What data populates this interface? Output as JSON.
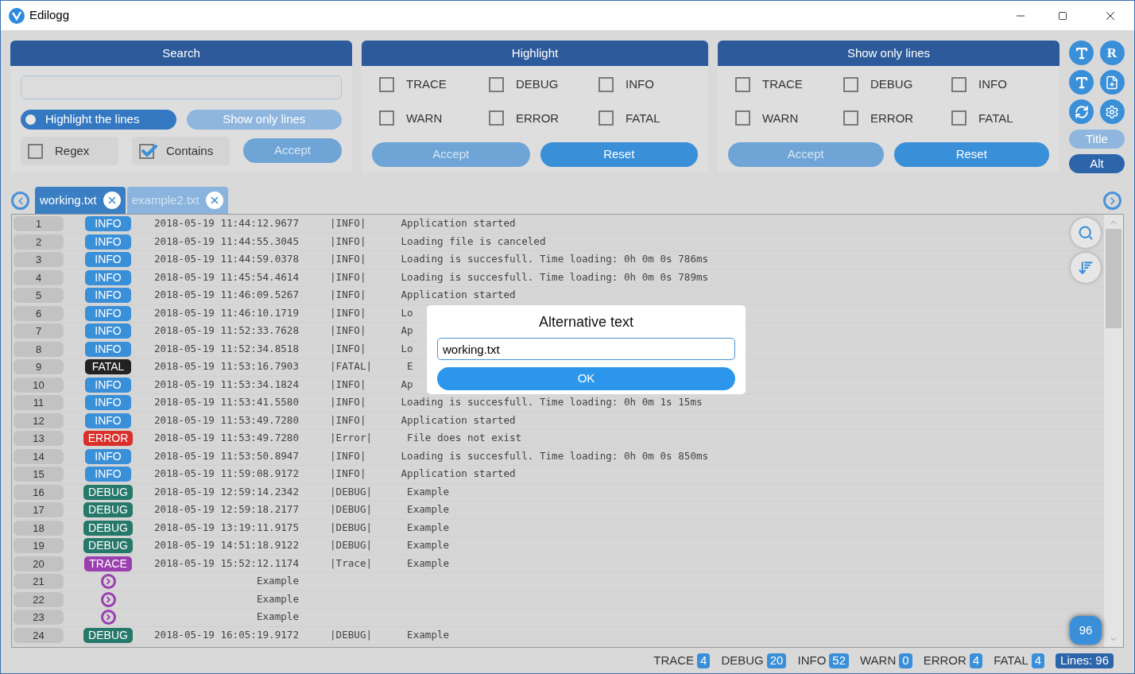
{
  "window": {
    "title": "Edilogg"
  },
  "search": {
    "title": "Search",
    "modes": [
      {
        "label": "Highlight the lines",
        "selected": true
      },
      {
        "label": "Show only lines",
        "selected": false
      }
    ],
    "regex": {
      "label": "Regex",
      "checked": false
    },
    "contains": {
      "label": "Contains",
      "checked": true
    },
    "accept": {
      "label": "Accept",
      "disabled": true
    }
  },
  "highlight": {
    "title": "Highlight",
    "levels": [
      {
        "label": "TRACE",
        "checked": false
      },
      {
        "label": "DEBUG",
        "checked": false
      },
      {
        "label": "INFO",
        "checked": false
      },
      {
        "label": "WARN",
        "checked": false
      },
      {
        "label": "ERROR",
        "checked": false
      },
      {
        "label": "FATAL",
        "checked": false
      }
    ],
    "buttons": [
      {
        "label": "Accept",
        "disabled": true
      },
      {
        "label": "Reset",
        "disabled": false
      }
    ]
  },
  "show_only": {
    "title": "Show only lines",
    "levels": [
      {
        "label": "TRACE",
        "checked": false
      },
      {
        "label": "DEBUG",
        "checked": false
      },
      {
        "label": "INFO",
        "checked": false
      },
      {
        "label": "WARN",
        "checked": false
      },
      {
        "label": "ERROR",
        "checked": false
      },
      {
        "label": "FATAL",
        "checked": false
      }
    ],
    "buttons": [
      {
        "label": "Accept",
        "disabled": true
      },
      {
        "label": "Reset",
        "disabled": false
      }
    ]
  },
  "side": {
    "r_button": "R",
    "toggles": [
      {
        "label": "Title",
        "selected": false
      },
      {
        "label": "Alt",
        "selected": true
      }
    ]
  },
  "tabs": [
    {
      "label": "working.txt",
      "selected": true
    },
    {
      "label": "example2.txt",
      "selected": false
    }
  ],
  "rows": [
    {
      "number": "1",
      "kind": "entry",
      "level": "INFO",
      "color": "#3a8fd9",
      "timestamp": "2018-05-19 11:44:12.9677",
      "type": "|INFO|",
      "message": "Application started"
    },
    {
      "number": "2",
      "kind": "entry",
      "level": "INFO",
      "color": "#3a8fd9",
      "timestamp": "2018-05-19 11:44:55.3045",
      "type": "|INFO|",
      "message": "Loading file is canceled"
    },
    {
      "number": "3",
      "kind": "entry",
      "level": "INFO",
      "color": "#3a8fd9",
      "timestamp": "2018-05-19 11:44:59.0378",
      "type": "|INFO|",
      "message": "Loading is succesfull. Time loading: 0h 0m 0s 786ms"
    },
    {
      "number": "4",
      "kind": "entry",
      "level": "INFO",
      "color": "#3a8fd9",
      "timestamp": "2018-05-19 11:45:54.4614",
      "type": "|INFO|",
      "message": "Loading is succesfull. Time loading: 0h 0m 0s 789ms"
    },
    {
      "number": "5",
      "kind": "entry",
      "level": "INFO",
      "color": "#3a8fd9",
      "timestamp": "2018-05-19 11:46:09.5267",
      "type": "|INFO|",
      "message": "Application started"
    },
    {
      "number": "6",
      "kind": "entry",
      "level": "INFO",
      "color": "#3a8fd9",
      "timestamp": "2018-05-19 11:46:10.1719",
      "type": "|INFO|",
      "message": "Lo"
    },
    {
      "number": "7",
      "kind": "entry",
      "level": "INFO",
      "color": "#3a8fd9",
      "timestamp": "2018-05-19 11:52:33.7628",
      "type": "|INFO|",
      "message": "Ap"
    },
    {
      "number": "8",
      "kind": "entry",
      "level": "INFO",
      "color": "#3a8fd9",
      "timestamp": "2018-05-19 11:52:34.8518",
      "type": "|INFO|",
      "message": "Lo"
    },
    {
      "number": "9",
      "kind": "entry",
      "level": "FATAL",
      "color": "#222222",
      "timestamp": "2018-05-19 11:53:16.7903",
      "type": "|FATAL|",
      "message": "E"
    },
    {
      "number": "10",
      "kind": "entry",
      "level": "INFO",
      "color": "#3a8fd9",
      "timestamp": "2018-05-19 11:53:34.1824",
      "type": "|INFO|",
      "message": "Ap"
    },
    {
      "number": "11",
      "kind": "entry",
      "level": "INFO",
      "color": "#3a8fd9",
      "timestamp": "2018-05-19 11:53:41.5580",
      "type": "|INFO|",
      "message": "Loading is succesfull. Time loading: 0h 0m 1s 15ms"
    },
    {
      "number": "12",
      "kind": "entry",
      "level": "INFO",
      "color": "#3a8fd9",
      "timestamp": "2018-05-19 11:53:49.7280",
      "type": "|INFO|",
      "message": "Application started"
    },
    {
      "number": "13",
      "kind": "entry",
      "level": "ERROR",
      "color": "#d9302c",
      "timestamp": "2018-05-19 11:53:49.7280",
      "type": "|Error|",
      "message": "File does not exist"
    },
    {
      "number": "14",
      "kind": "entry",
      "level": "INFO",
      "color": "#3a8fd9",
      "timestamp": "2018-05-19 11:53:50.8947",
      "type": "|INFO|",
      "message": "Loading is succesfull. Time loading: 0h 0m 0s 850ms"
    },
    {
      "number": "15",
      "kind": "entry",
      "level": "INFO",
      "color": "#3a8fd9",
      "timestamp": "2018-05-19 11:59:08.9172",
      "type": "|INFO|",
      "message": "Application started"
    },
    {
      "number": "16",
      "kind": "entry",
      "level": "DEBUG",
      "color": "#26786a",
      "timestamp": "2018-05-19 12:59:14.2342",
      "type": "|DEBUG|",
      "message": "Example"
    },
    {
      "number": "17",
      "kind": "entry",
      "level": "DEBUG",
      "color": "#26786a",
      "timestamp": "2018-05-19 12:59:18.2177",
      "type": "|DEBUG|",
      "message": "Example"
    },
    {
      "number": "18",
      "kind": "entry",
      "level": "DEBUG",
      "color": "#26786a",
      "timestamp": "2018-05-19 13:19:11.9175",
      "type": "|DEBUG|",
      "message": "Example"
    },
    {
      "number": "19",
      "kind": "entry",
      "level": "DEBUG",
      "color": "#26786a",
      "timestamp": "2018-05-19 14:51:18.9122",
      "type": "|DEBUG|",
      "message": "Example"
    },
    {
      "number": "20",
      "kind": "entry",
      "level": "TRACE",
      "color": "#9b3fb0",
      "timestamp": "2018-05-19 15:52:12.1174",
      "type": "|Trace|",
      "message": "Example"
    },
    {
      "number": "21",
      "kind": "continuation",
      "color": "#9b3fb0",
      "message": "Example"
    },
    {
      "number": "22",
      "kind": "continuation",
      "color": "#9b3fb0",
      "message": "Example"
    },
    {
      "number": "23",
      "kind": "continuation",
      "color": "#9b3fb0",
      "message": "Example"
    },
    {
      "number": "24",
      "kind": "entry",
      "level": "DEBUG",
      "color": "#26786a",
      "timestamp": "2018-05-19 16:05:19.9172",
      "type": "|DEBUG|",
      "message": "Example"
    }
  ],
  "line_count_badge": "96",
  "dialog": {
    "title": "Alternative text",
    "value": "working.txt",
    "button": "OK"
  },
  "status_bar": {
    "counts": [
      {
        "label": "TRACE",
        "count": "4"
      },
      {
        "label": "DEBUG",
        "count": "20"
      },
      {
        "label": "INFO",
        "count": "52"
      },
      {
        "label": "WARN",
        "count": "0"
      },
      {
        "label": "ERROR",
        "count": "4"
      },
      {
        "label": "FATAL",
        "count": "4"
      }
    ],
    "lines": "Lines: 96"
  }
}
